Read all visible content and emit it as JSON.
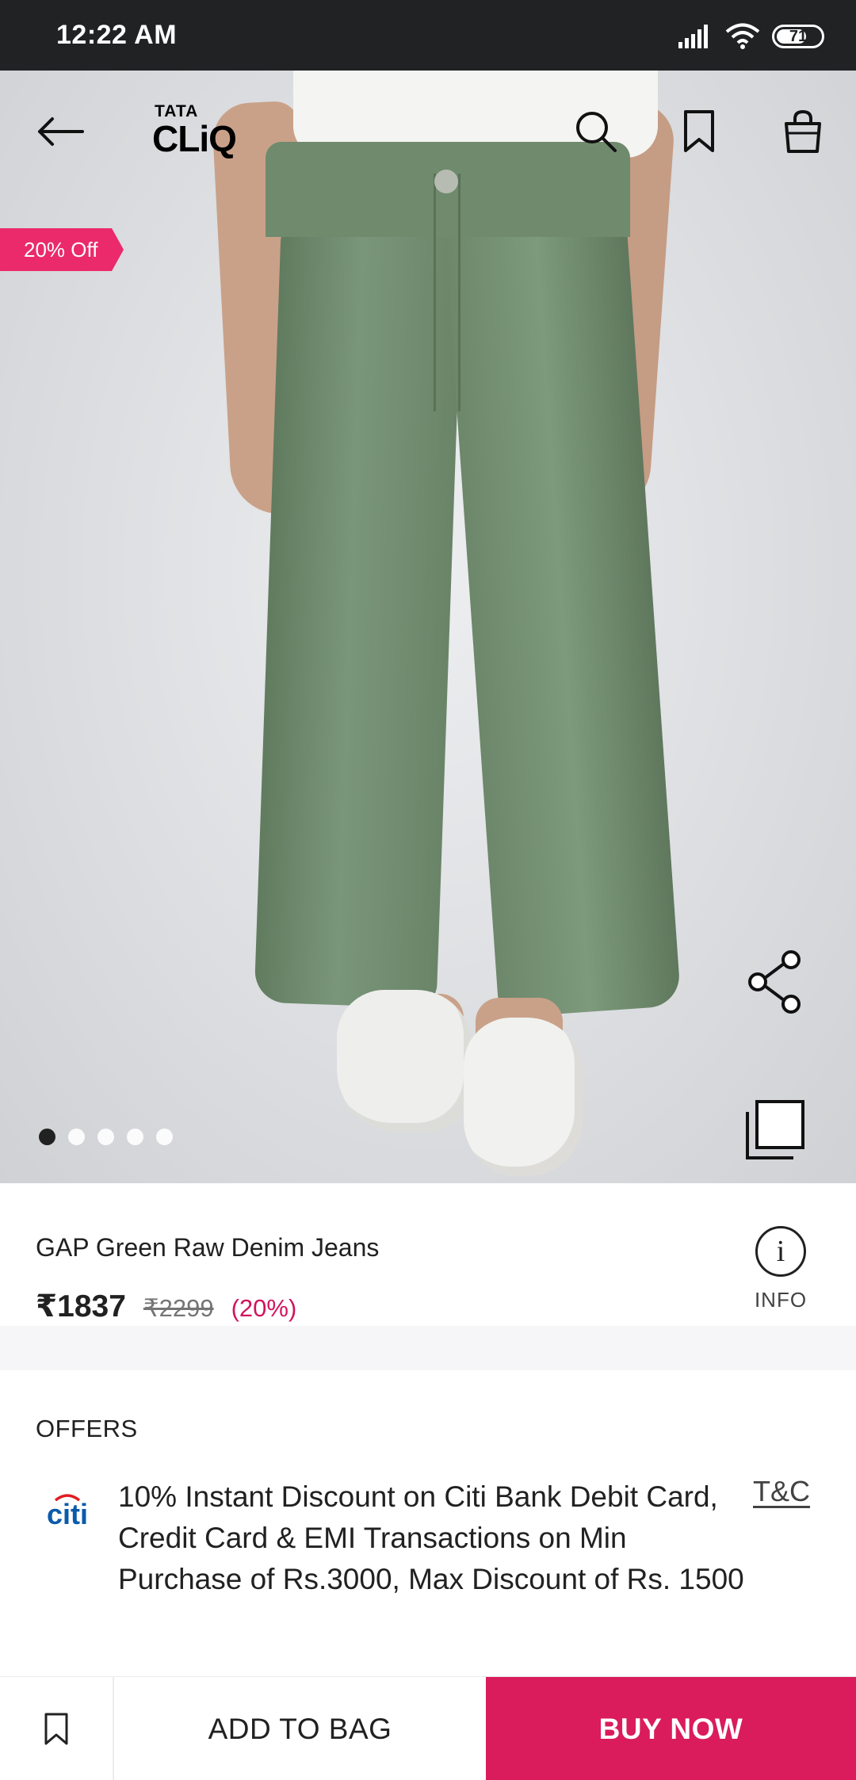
{
  "status_bar": {
    "time": "12:22 AM",
    "battery": "71",
    "battery_level": 0.71
  },
  "header": {
    "logo_top": "TATA",
    "logo_bottom": "CLiQ",
    "icons": [
      "back-arrow-icon",
      "search-icon",
      "bookmark-icon",
      "shopping-bag-icon"
    ]
  },
  "gallery": {
    "discount_badge": "20% Off",
    "image_count": 5,
    "active_index": 0,
    "icons": [
      "share-icon",
      "gallery-icon"
    ]
  },
  "product": {
    "name": "GAP Green Raw Denim Jeans",
    "price": "₹1837",
    "mrp": "₹2299",
    "discount_pct": "(20%)",
    "info_label": "INFO"
  },
  "offers": {
    "title": "OFFERS",
    "items": [
      {
        "logo": "citi",
        "text": "10% Instant Discount on Citi Bank Debit Card, Credit Card & EMI Transactions on Min Purchase of Rs.3000, Max Discount of Rs. 1500",
        "tnc": "T&C"
      }
    ]
  },
  "actions": {
    "add_to_bag": "ADD TO BAG",
    "buy_now": "BUY NOW"
  },
  "colors": {
    "brand_pink": "#da1c5c",
    "ribbon_pink": "#ea2a6a",
    "status_bar": "#212224",
    "citi_blue": "#0b5bab",
    "citi_red": "#e11b22"
  }
}
